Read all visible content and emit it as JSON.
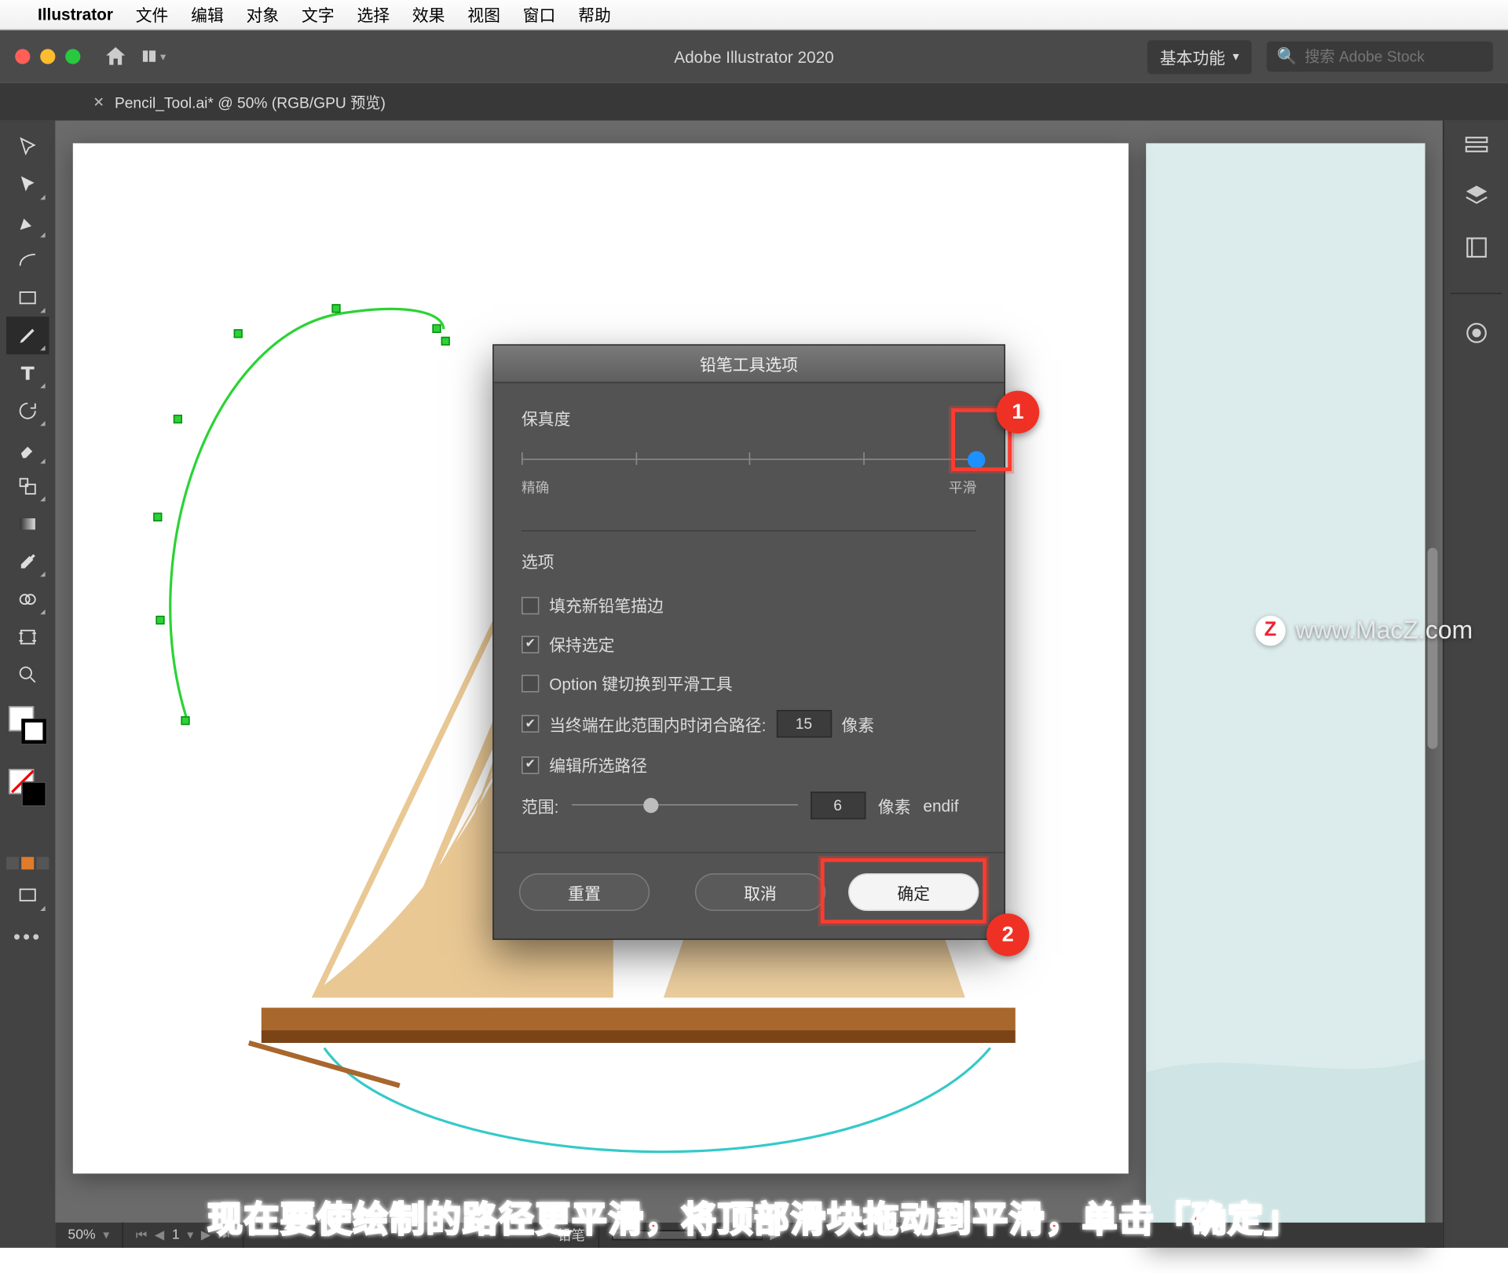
{
  "menubar": {
    "app": "Illustrator",
    "items": [
      "文件",
      "编辑",
      "对象",
      "文字",
      "选择",
      "效果",
      "视图",
      "窗口",
      "帮助"
    ]
  },
  "appbar": {
    "title": "Adobe Illustrator 2020",
    "workspace": "基本功能",
    "search_placeholder": "搜索 Adobe Stock"
  },
  "doc_tab": {
    "label": "Pencil_Tool.ai* @ 50% (RGB/GPU 预览)"
  },
  "dialog": {
    "title": "铅笔工具选项",
    "fidelity_label": "保真度",
    "fidelity_left": "精确",
    "fidelity_right": "平滑",
    "options_label": "选项",
    "opt_fill": "填充新铅笔描边",
    "opt_keep": "保持选定",
    "opt_option_smooth": "Option 键切换到平滑工具",
    "opt_close_path": "当终端在此范围内时闭合路径:",
    "opt_close_path_val": "15",
    "opt_close_path_unit": "像素",
    "opt_edit": "编辑所选路径",
    "range_label": "范围:",
    "range_val": "6",
    "range_unit": "像素",
    "btn_reset": "重置",
    "btn_cancel": "取消",
    "btn_ok": "确定",
    "badge1": "1",
    "badge2": "2"
  },
  "status": {
    "zoom": "50%",
    "artboard": "1",
    "tool": "铅笔"
  },
  "watermark": {
    "z": "Z",
    "text": "www.MacZ.com"
  },
  "caption": "现在要使绘制的路径更平滑，将顶部滑块拖动到平滑，单击「确定」"
}
